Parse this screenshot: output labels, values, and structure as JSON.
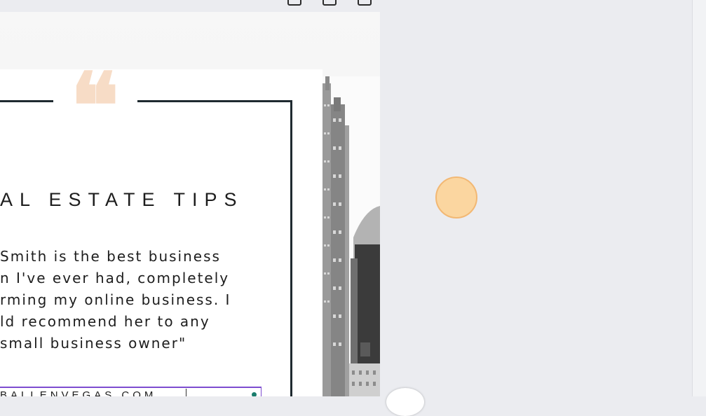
{
  "canvas": {
    "heading": "AL ESTATE TIPS",
    "quote_mark": "❝",
    "quote_lines": [
      "Smith is the best business",
      "n I've ever had, completely",
      "rming my online business. I",
      "ld recommend her to any",
      "small business owner\""
    ],
    "website": "BALLENVEGAS.COM"
  },
  "colors": {
    "frame": "#1f2a30",
    "quote_mark": "#f7dcc6",
    "selection": "#7d4cd0",
    "cursor_fill": "#fbd6a0",
    "cursor_ring": "#f2b874",
    "workspace": "#ebecf0"
  },
  "icons": {
    "toolbar": [
      "add-page-icon",
      "duplicate-page-icon",
      "delete-page-icon"
    ]
  }
}
